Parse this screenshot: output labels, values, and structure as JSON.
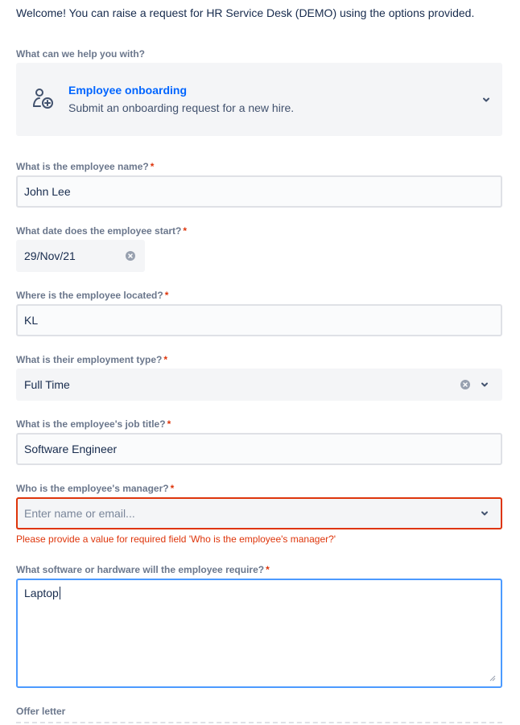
{
  "welcome": "Welcome! You can raise a request for HR Service Desk (DEMO) using the options provided.",
  "request_type": {
    "label": "What can we help you with?",
    "title": "Employee onboarding",
    "description": "Submit an onboarding request for a new hire.",
    "icon": "user-add-icon"
  },
  "fields": {
    "name": {
      "label": "What is the employee name?",
      "required": "*",
      "value": "John Lee"
    },
    "start_date": {
      "label": "What date does the employee start?",
      "required": "*",
      "value": "29/Nov/21"
    },
    "location": {
      "label": "Where is the employee located?",
      "required": "*",
      "value": "KL"
    },
    "employment_type": {
      "label": "What is their employment type?",
      "required": "*",
      "value": "Full Time"
    },
    "job_title": {
      "label": "What is the employee's job title?",
      "required": "*",
      "value": "Software Engineer"
    },
    "manager": {
      "label": "Who is the employee's manager?",
      "required": "*",
      "placeholder": "Enter name or email...",
      "error": "Please provide a value for required field 'Who is the employee's manager?'"
    },
    "software": {
      "label": "What software or hardware will the employee require?",
      "required": "*",
      "value": "Laptop"
    },
    "offer_letter": {
      "label": "Offer letter"
    }
  },
  "colors": {
    "accent": "#0065ff",
    "error": "#de350b",
    "focus": "#4c9aff",
    "field_bg": "#f4f5f7"
  }
}
